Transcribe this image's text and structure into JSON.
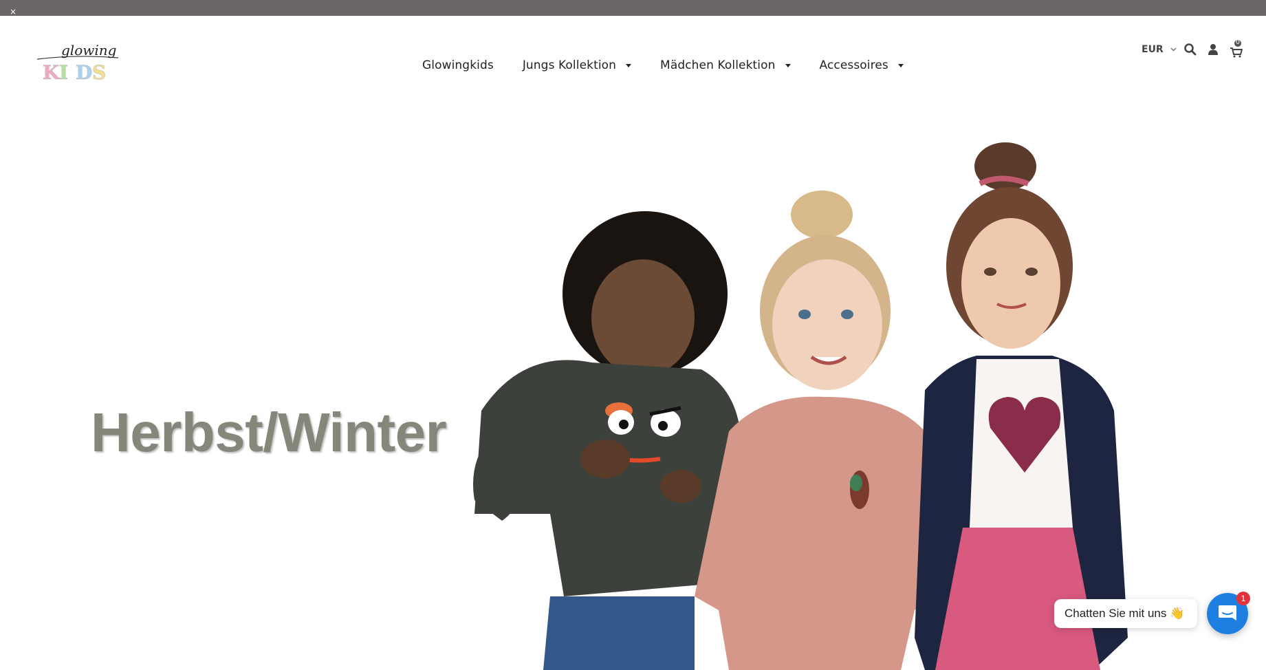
{
  "announcement_bar": {
    "close_icon": "close-icon",
    "close_glyph": "×"
  },
  "header": {
    "logo": {
      "script_text": "glowing",
      "letters": [
        "K",
        "I",
        "D",
        "S"
      ],
      "letter_colors": [
        "#f2a7c3",
        "#b7dfa3",
        "#a9d2ee",
        "#f4e18a"
      ]
    },
    "nav": [
      {
        "label": "Glowingkids",
        "has_dropdown": false
      },
      {
        "label": "Jungs Kollektion",
        "has_dropdown": true
      },
      {
        "label": "Mädchen Kollektion",
        "has_dropdown": true
      },
      {
        "label": "Accessoires",
        "has_dropdown": true
      }
    ],
    "currency": {
      "label": "EUR",
      "icon": "chevron-down-icon"
    },
    "icons": {
      "search": "search-icon",
      "account": "user-icon",
      "cart": "cart-icon"
    },
    "cart_count": "0"
  },
  "hero": {
    "title": "Herbst/Winter",
    "image": "children-autumn-winter-collection-photo"
  },
  "chat": {
    "bubble_text": "Chatten Sie mit uns 👋",
    "badge_count": "1",
    "icon": "chat-icon",
    "accent_color": "#1e7fe0"
  },
  "colors": {
    "topbar": "#6b6565",
    "hero_title": "#84887a",
    "badge": "#e5313a"
  }
}
